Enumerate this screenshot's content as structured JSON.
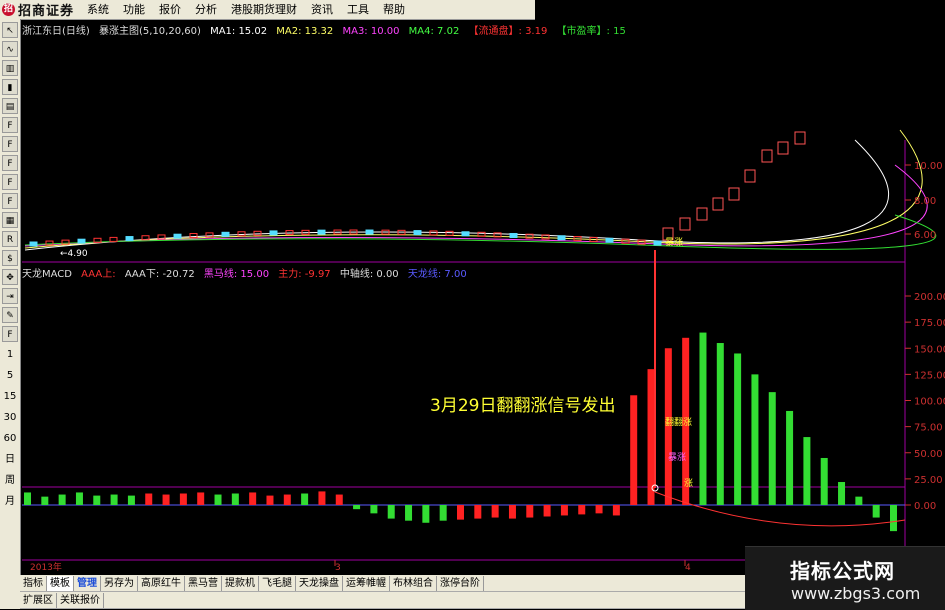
{
  "app": {
    "logo_text": "招商证券",
    "menu": [
      "系统",
      "功能",
      "报价",
      "分析",
      "港股期货理财",
      "资讯",
      "工具",
      "帮助"
    ]
  },
  "left_toolbar": {
    "items": [
      "1",
      "5",
      "15",
      "30",
      "60",
      "日",
      "周",
      "月"
    ]
  },
  "main_chart_header": {
    "title": "浙江东日(日线)",
    "indicator": "暴涨主图(5,10,20,60)",
    "ma1": "MA1: 15.02",
    "ma2": "MA2: 13.32",
    "ma3": "MA3: 10.00",
    "ma4": "MA4: 7.02",
    "float": "【流通盘】: 3.19",
    "pe": "【市盈率】: 15"
  },
  "sub_chart_header": {
    "title": "天龙MACD",
    "aaa_up": "AAA上:",
    "aaa_down": "AAA下: -20.72",
    "black_horse": "黑马线: 15.00",
    "main_force": "主力: -9.97",
    "middle": "中轴线: 0.00",
    "sky_dragon": "天龙线: 7.00"
  },
  "annotation": "3月29日翻翻涨信号发出",
  "chart_labels": {
    "min_price": "←4.90",
    "signal_label": "暴涨",
    "bar_label1": "翻翻涨",
    "bar_label2": "暴涨",
    "bar_label3": "涨"
  },
  "x_axis": [
    "2013年",
    "3",
    "4"
  ],
  "price_axis": [
    "10.00",
    "8.00",
    "6.00"
  ],
  "macd_axis": [
    "200.00",
    "175.00",
    "150.00",
    "125.00",
    "100.00",
    "75.00",
    "50.00",
    "25.00",
    "0.00"
  ],
  "tabs_row1": [
    "指标",
    "模板",
    "管理",
    "另存为",
    "高原红牛",
    "黑马营",
    "提款机",
    "飞毛腿",
    "天龙操盘",
    "运筹帷幄",
    "布林组合",
    "涨停台阶"
  ],
  "tabs_row2": [
    "扩展区",
    "关联报价"
  ],
  "watermark": {
    "title": "指标公式网",
    "url": "www.zbgs3.com"
  },
  "colors": {
    "up": "#ff3333",
    "down": "#33dd33",
    "grid_border": "#a000a0",
    "annotation": "#ffff33",
    "axis_text": "#cc3030"
  },
  "chart_data": [
    {
      "type": "line",
      "series": [
        {
          "name": "MA1",
          "values": [
            15.02
          ]
        },
        {
          "name": "MA2",
          "values": [
            13.32
          ]
        },
        {
          "name": "MA3",
          "values": [
            10.0
          ]
        },
        {
          "name": "MA4",
          "values": [
            7.02
          ]
        }
      ],
      "ylabel": "",
      "y_ticks": [
        6.0,
        8.0,
        10.0
      ]
    },
    {
      "type": "bar",
      "values": [
        12,
        8,
        10,
        12,
        9,
        10,
        9,
        11,
        10,
        11,
        12,
        10,
        11,
        12,
        9,
        10,
        11,
        13,
        10,
        -4,
        -8,
        -13,
        -15,
        -17,
        -15,
        -14,
        -13,
        -12,
        -13,
        -12,
        -11,
        -10,
        -9,
        -8,
        -10,
        105,
        130,
        150,
        160,
        165,
        155,
        145,
        125,
        108,
        90,
        65,
        45,
        22,
        8,
        -12,
        -25
      ],
      "colors_sign": [
        "g",
        "g",
        "g",
        "g",
        "g",
        "g",
        "g",
        "r",
        "r",
        "r",
        "r",
        "g",
        "g",
        "r",
        "r",
        "r",
        "g",
        "r",
        "r",
        "g",
        "g",
        "g",
        "g",
        "g",
        "g",
        "r",
        "r",
        "r",
        "r",
        "r",
        "r",
        "r",
        "r",
        "r",
        "r",
        "r",
        "r",
        "r",
        "r",
        "g",
        "g",
        "g",
        "g",
        "g",
        "g",
        "g",
        "g",
        "g",
        "g",
        "g",
        "g"
      ],
      "y_ticks": [
        0,
        25,
        50,
        75,
        100,
        125,
        150,
        175,
        200
      ]
    }
  ]
}
